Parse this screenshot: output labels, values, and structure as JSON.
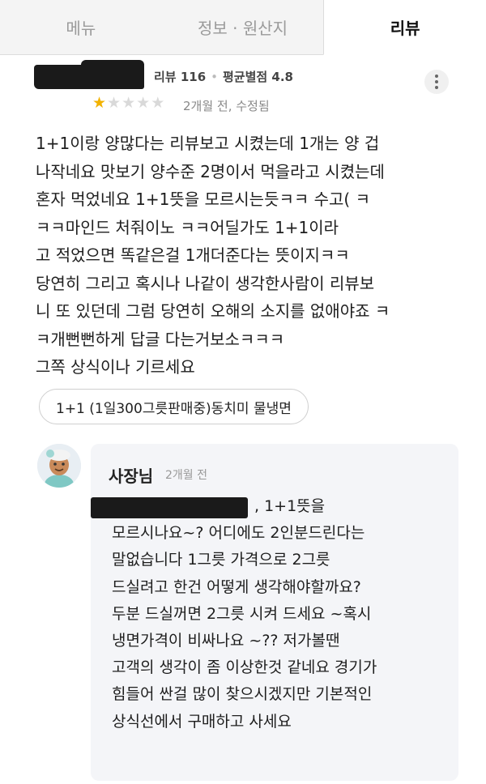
{
  "tabs": [
    {
      "label": "메뉴",
      "active": false
    },
    {
      "label": "정보 · 원산지",
      "active": false
    },
    {
      "label": "리뷰",
      "active": true
    }
  ],
  "review": {
    "review_count_label": "리뷰 116",
    "avg_label": "평균별점 4.8",
    "rating": 1,
    "rating_max": 5,
    "date": "2개월 전, 수정됨",
    "body_lines": [
      "1+1이랑 양많다는 리뷰보고 시켰는데 1개는 양 겁",
      "나작네요 맛보기 양수준 2명이서 먹을라고 시켰는데",
      " 혼자 먹었네요 1+1뜻을 모르시는듯ㅋㅋ 수고( ㅋ",
      "ㅋㅋ마인드 처줘이노 ㅋㅋ어딜가도 1+1이라",
      "고 적었으면 똑같은걸 1개더준다는 뜻이지ㅋㅋ",
      "당연히 그리고 혹시나 나같이 생각한사람이 리뷰보",
      "니 또 있던데 그럼 당연히 오해의 소지를 없애야죠 ㅋ",
      "ㅋ개뻔뻔하게 답글 다는거보소ㅋㅋㅋ",
      "그쪽 상식이나 기르세요"
    ],
    "menu_tag": "1+1 (1일300그릇판매중)동치미 물냉면"
  },
  "reply": {
    "author": "사장님",
    "date": "2개월 전",
    "body_lines": [
      ", 1+1뜻을",
      "모르시나요~? 어디에도 2인분드린다는",
      "말없습니다 1그릇 가격으로 2그릇",
      "드실려고 한건 어떻게 생각해야할까요?",
      "두분 드실꺼면 2그릇 시켜 드세요 ~혹시",
      "냉면가격이 비싸나요 ~?? 저가볼땐",
      "고객의 생각이  좀 이상한것 같네요 경기가",
      "힘들어 싼걸 많이 찾으시겠지만 기본적인",
      "상식선에서 구매하고 사세요"
    ]
  },
  "colors": {
    "star_on": "#f2b200",
    "star_off": "#d9d9d9",
    "reply_bg": "#f4f5f8",
    "redaction": "#1a1a1a"
  },
  "icons": {
    "more": "more-vertical-icon",
    "star": "star-icon",
    "avatar": "owner-avatar-icon"
  }
}
